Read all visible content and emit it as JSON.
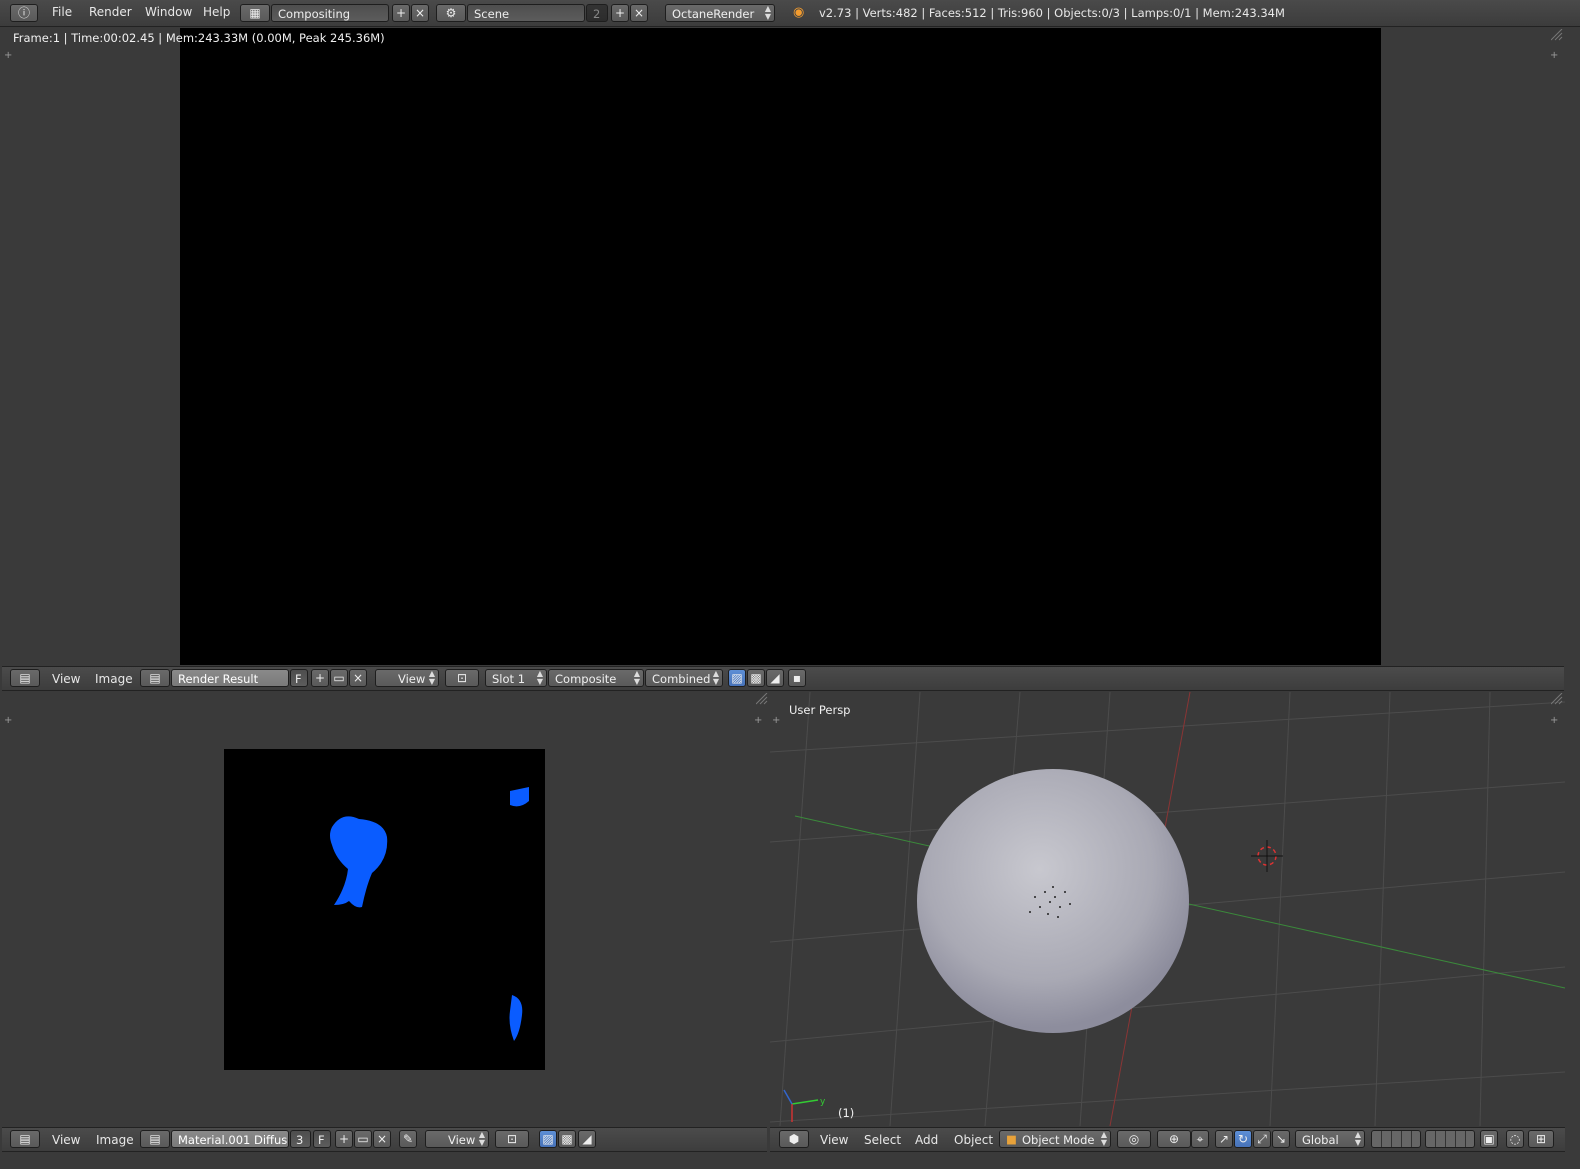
{
  "topbar": {
    "menus": [
      "File",
      "Render",
      "Window",
      "Help"
    ],
    "layout": "Compositing",
    "scene": "Scene",
    "scene_users": "2",
    "engine": "OctaneRender",
    "stats": "v2.73 | Verts:482 | Faces:512 | Tris:960 | Objects:0/3 | Lamps:0/1 | Mem:243.34M"
  },
  "render_view": {
    "frame_info": "Frame:1 | Time:00:02.45 | Mem:243.33M (0.00M, Peak 245.36M)"
  },
  "render_header": {
    "menus": [
      "View",
      "Image"
    ],
    "image_name": "Render Result",
    "fake_user": "F",
    "view": "View",
    "slot": "Slot 1",
    "layer": "Composite",
    "pass": "Combined"
  },
  "texture_header": {
    "menus": [
      "View",
      "Image"
    ],
    "image_name": "Material.001 Diffus...",
    "users": "3",
    "fake_user": "F",
    "view": "View"
  },
  "viewport": {
    "label": "User Persp",
    "frame": "(1)",
    "menus": [
      "View",
      "Select",
      "Add",
      "Object"
    ],
    "mode": "Object Mode",
    "orientation": "Global"
  },
  "colors": {
    "accent": "#5680c2",
    "texture_blob": "#0a5cff"
  }
}
